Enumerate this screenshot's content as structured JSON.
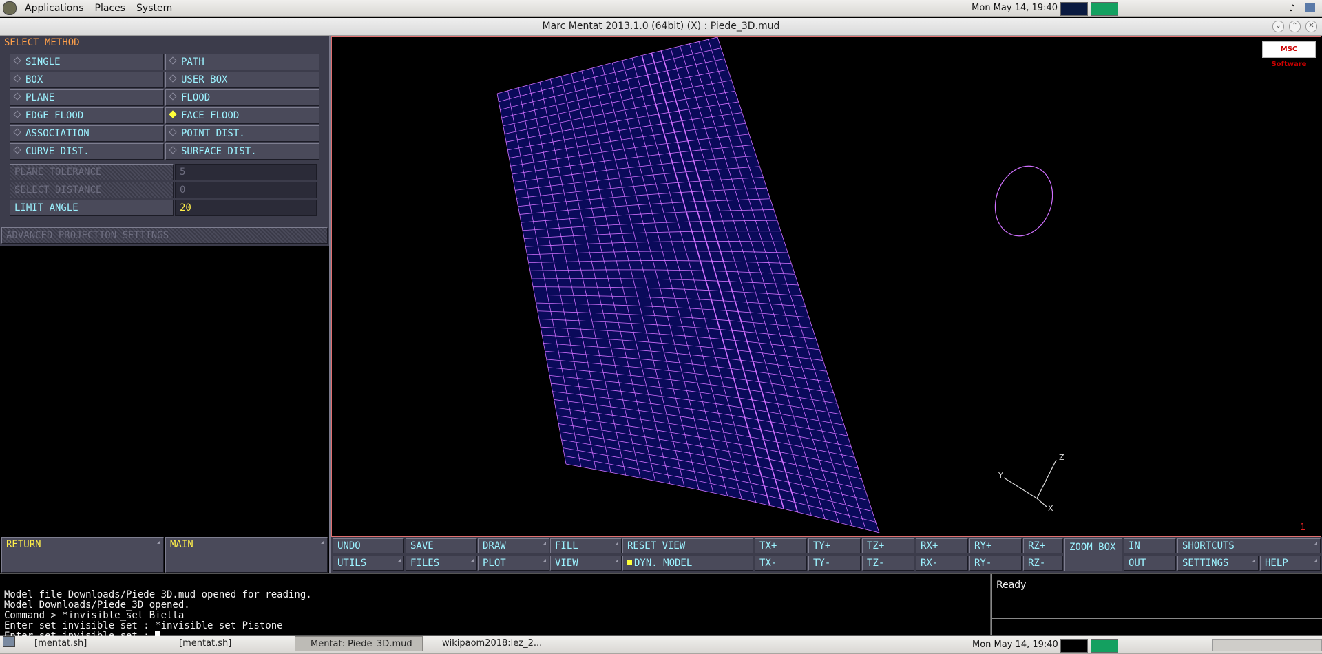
{
  "top_panel": {
    "menus": [
      "Applications",
      "Places",
      "System"
    ],
    "clock": "Mon May 14, 19:40"
  },
  "window": {
    "title": "Marc Mentat 2013.1.0 (64bit) (X) : Piede_3D.mud"
  },
  "select_method": {
    "header": "SELECT METHOD",
    "buttons": [
      {
        "label": "SINGLE"
      },
      {
        "label": "PATH"
      },
      {
        "label": "BOX"
      },
      {
        "label": "USER BOX"
      },
      {
        "label": "PLANE"
      },
      {
        "label": "FLOOD"
      },
      {
        "label": "EDGE FLOOD"
      },
      {
        "label": "FACE FLOOD"
      },
      {
        "label": "ASSOCIATION"
      },
      {
        "label": "POINT DIST."
      },
      {
        "label": "CURVE DIST."
      },
      {
        "label": "SURFACE DIST."
      }
    ],
    "selected": "FACE FLOOD",
    "fields": [
      {
        "label": "PLANE TOLERANCE",
        "value": "5"
      },
      {
        "label": "SELECT DISTANCE",
        "value": "0"
      },
      {
        "label": "LIMIT ANGLE",
        "value": "20"
      }
    ],
    "advanced": "ADVANCED PROJECTION SETTINGS"
  },
  "nav": {
    "return": "RETURN",
    "main": "MAIN"
  },
  "viewport": {
    "logo": "MSC Software",
    "axes": {
      "y": "Y",
      "z": "Z",
      "x": "X"
    },
    "view_number": "1"
  },
  "toolbar": {
    "row1": [
      "UNDO",
      "SAVE",
      "DRAW",
      "FILL",
      "RESET VIEW",
      "TX+",
      "TY+",
      "TZ+",
      "RX+",
      "RY+",
      "RZ+",
      "IN",
      "SHORTCUTS"
    ],
    "row2": [
      "UTILS",
      "FILES",
      "PLOT",
      "VIEW",
      "DYN. MODEL",
      "TX-",
      "TY-",
      "TZ-",
      "RX-",
      "RY-",
      "RZ-",
      "OUT",
      "SETTINGS",
      "HELP"
    ],
    "zoom_box": "ZOOM BOX"
  },
  "command_lines": [
    "Model file Downloads/Piede_3D.mud opened for reading.",
    "Model Downloads/Piede_3D opened.",
    "Command > *invisible_set Biella",
    "Enter set invisible set : *invisible_set Pistone",
    "Enter set invisible set : "
  ],
  "status": "Ready",
  "taskbar": {
    "items": [
      "[mentat.sh]",
      "[mentat.sh]",
      "Mentat: Piede_3D.mud",
      "wikipaom2018:lez_2..."
    ],
    "clock": "Mon May 14, 19:40"
  },
  "colors": {
    "mesh": "#d070ff",
    "mesh_fill": "#0a0a5a",
    "button_text": "#9cf2ff",
    "header": "#ffa04a"
  }
}
